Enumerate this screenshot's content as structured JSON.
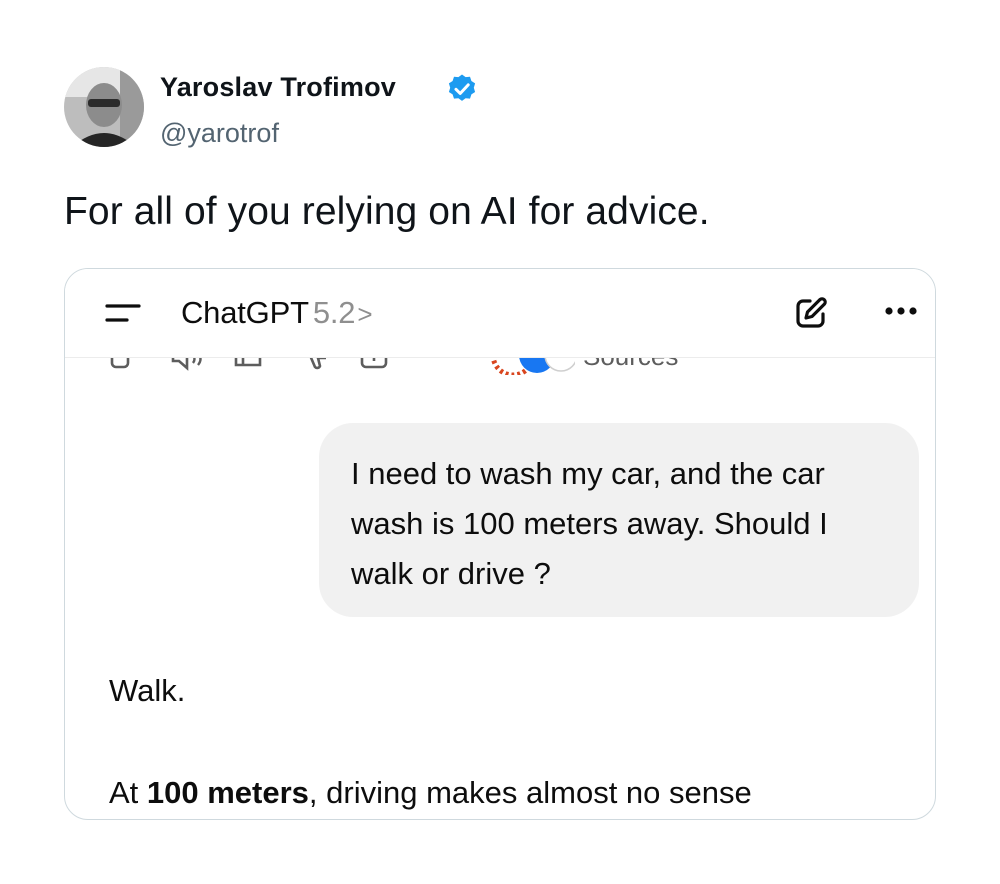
{
  "author": {
    "name": "Yaroslav Trofimov",
    "handle": "@yarotrof",
    "verified": true,
    "verified_color": "#1d9bf0"
  },
  "tweet": {
    "text": "For all of you relying on AI for advice."
  },
  "embedded_screenshot": {
    "app_title": "ChatGPT",
    "model_version": "5.2",
    "chevron": ">",
    "header_icons": [
      "menu-icon",
      "edit-icon",
      "more-icon"
    ],
    "action_icons": [
      "copy-icon",
      "speaker-icon",
      "thumbs-up-icon",
      "thumbs-down-icon",
      "share-icon",
      "more-dots-icon"
    ],
    "sources_label": "Sources",
    "user_message": "I need to wash my car, and the car wash is 100 meters away. Should I walk or drive ?",
    "assistant_reply": {
      "first_line": "Walk.",
      "second_line_prefix": "At ",
      "second_line_bold": "100 meters",
      "second_line_suffix": ", driving makes almost no sense"
    }
  },
  "colors": {
    "bubble_bg": "#f1f1f1",
    "border": "#cfd9de",
    "secondary_text": "#536471"
  }
}
